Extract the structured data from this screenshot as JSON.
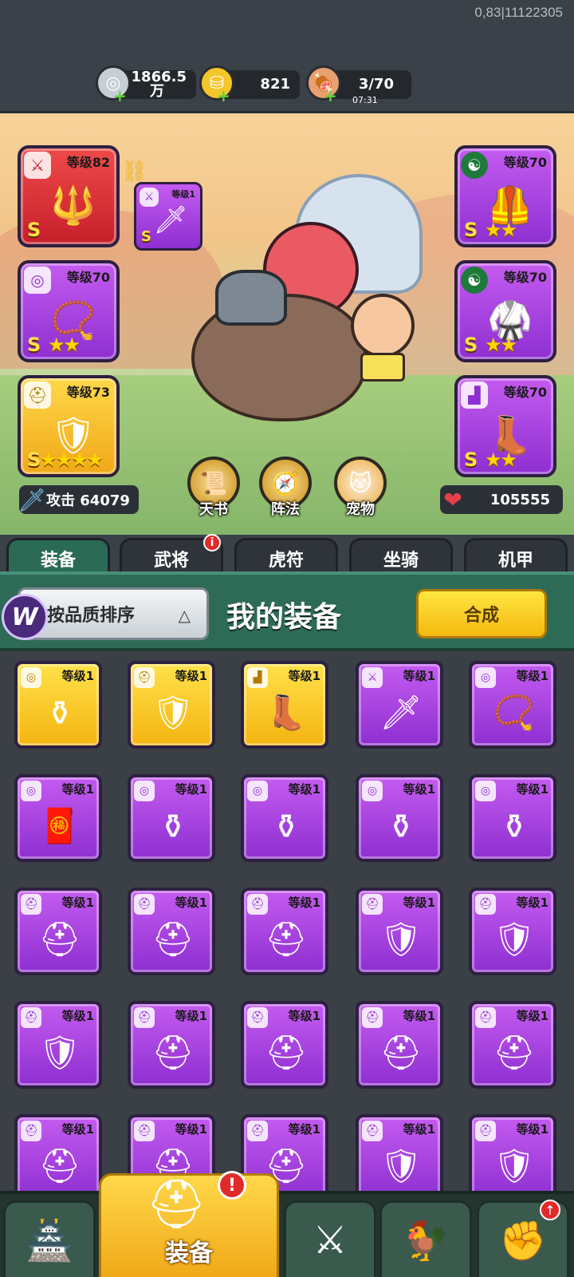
{
  "build_id": "0,83|11122305",
  "resources": {
    "silver": {
      "value": "1866.5\n万",
      "line1": "1866.5",
      "line2": "万"
    },
    "gold": {
      "value": "821"
    },
    "stamina": {
      "value": "3/70",
      "timer": "07:31"
    }
  },
  "equipped": {
    "weapon": {
      "level": "等级82",
      "grade": "S"
    },
    "weapon_sub": {
      "level": "等级1",
      "grade": "S"
    },
    "necklace": {
      "level": "等级70",
      "grade": "S",
      "stars": 2
    },
    "helmet": {
      "level": "等级73",
      "grade": "S",
      "stars": 4
    },
    "armor": {
      "level": "等级70",
      "grade": "S",
      "stars": 2
    },
    "bracer": {
      "level": "等级70",
      "grade": "S",
      "stars": 2
    },
    "boots": {
      "level": "等级70",
      "grade": "S",
      "stars": 2
    }
  },
  "skills": [
    {
      "label": "天书",
      "icon": "scroll-icon"
    },
    {
      "label": "阵法",
      "icon": "formation-icon"
    },
    {
      "label": "宠物",
      "icon": "pet-cat-icon"
    }
  ],
  "stats": {
    "attack": "攻击 64079",
    "hp": "105555"
  },
  "tabs": [
    {
      "label": "装备",
      "active": true
    },
    {
      "label": "武将",
      "alert": true
    },
    {
      "label": "虎符"
    },
    {
      "label": "坐骑"
    },
    {
      "label": "机甲"
    }
  ],
  "sort": {
    "label": "按品质排序"
  },
  "title": "我的装备",
  "synth_label": "合成",
  "inventory": [
    {
      "level": "等级1",
      "type": "necklace",
      "color": "gold",
      "icon": "⚱"
    },
    {
      "level": "等级1",
      "type": "helmet",
      "color": "gold",
      "icon": "🛡"
    },
    {
      "level": "等级1",
      "type": "boots",
      "color": "gold",
      "icon": "👢"
    },
    {
      "level": "等级1",
      "type": "weapon",
      "color": "purple",
      "icon": "🗡"
    },
    {
      "level": "等级1",
      "type": "necklace",
      "color": "purple",
      "icon": "📿"
    },
    {
      "level": "等级1",
      "type": "necklace",
      "color": "purple",
      "icon": "🧧"
    },
    {
      "level": "等级1",
      "type": "necklace",
      "color": "purple",
      "icon": "⚱"
    },
    {
      "level": "等级1",
      "type": "necklace",
      "color": "purple",
      "icon": "⚱"
    },
    {
      "level": "等级1",
      "type": "necklace",
      "color": "purple",
      "icon": "⚱"
    },
    {
      "level": "等级1",
      "type": "necklace",
      "color": "purple",
      "icon": "⚱"
    },
    {
      "level": "等级1",
      "type": "helmet",
      "color": "purple",
      "icon": "⛑"
    },
    {
      "level": "等级1",
      "type": "helmet",
      "color": "purple",
      "icon": "⛑"
    },
    {
      "level": "等级1",
      "type": "helmet",
      "color": "purple",
      "icon": "⛑"
    },
    {
      "level": "等级1",
      "type": "helmet",
      "color": "purple",
      "icon": "🛡"
    },
    {
      "level": "等级1",
      "type": "helmet",
      "color": "purple",
      "icon": "🛡"
    },
    {
      "level": "等级1",
      "type": "helmet",
      "color": "purple",
      "icon": "🛡"
    },
    {
      "level": "等级1",
      "type": "helmet",
      "color": "purple",
      "icon": "⛑"
    },
    {
      "level": "等级1",
      "type": "helmet",
      "color": "purple",
      "icon": "⛑"
    },
    {
      "level": "等级1",
      "type": "helmet",
      "color": "purple",
      "icon": "⛑"
    },
    {
      "level": "等级1",
      "type": "helmet",
      "color": "purple",
      "icon": "⛑"
    },
    {
      "level": "等级1",
      "type": "helmet",
      "color": "purple",
      "icon": "⛑"
    },
    {
      "level": "等级1",
      "type": "helmet",
      "color": "purple",
      "icon": "⛑"
    },
    {
      "level": "等级1",
      "type": "helmet",
      "color": "purple",
      "icon": "⛑"
    },
    {
      "level": "等级1",
      "type": "helmet",
      "color": "purple",
      "icon": "🛡"
    },
    {
      "level": "等级1",
      "type": "helmet",
      "color": "purple",
      "icon": "🛡"
    }
  ],
  "bottom_nav": [
    {
      "name": "city",
      "icon": "🏯"
    },
    {
      "name": "equip",
      "label": "装备",
      "icon": "⛑",
      "active": true,
      "alert": "!"
    },
    {
      "name": "battle",
      "icon": "⚔"
    },
    {
      "name": "heroes",
      "icon": "🐓"
    },
    {
      "name": "upgrade",
      "icon": "✊"
    }
  ],
  "colors": {
    "gold": "#ffd84a",
    "purple": "#c45bf0",
    "red": "#ef4a4a",
    "green_panel": "#2e6b57",
    "alert": "#e12a2a"
  }
}
